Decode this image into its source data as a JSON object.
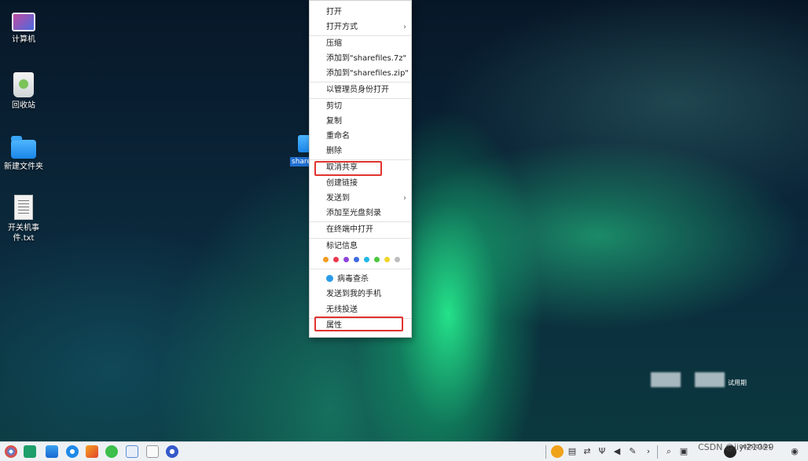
{
  "desktop": {
    "icons": [
      {
        "label": "计算机",
        "icon": "computer-icon"
      },
      {
        "label": "回收站",
        "icon": "recycle-bin-icon"
      },
      {
        "label": "新建文件夹",
        "icon": "folder-icon"
      },
      {
        "label": "开关机事件.txt",
        "icon": "text-file-icon"
      }
    ],
    "selected_file": {
      "label": "share",
      "icon": "folder-icon"
    }
  },
  "context_menu": {
    "items": [
      {
        "label": "打开"
      },
      {
        "label": "打开方式",
        "submenu": true
      },
      {
        "label": "压缩"
      },
      {
        "label": "添加到\"sharefiles.7z\""
      },
      {
        "label": "添加到\"sharefiles.zip\""
      },
      {
        "label": "以管理员身份打开"
      },
      {
        "label": "剪切"
      },
      {
        "label": "复制"
      },
      {
        "label": "重命名"
      },
      {
        "label": "删除"
      },
      {
        "label": "取消共享",
        "highlighted": true
      },
      {
        "label": "创建链接"
      },
      {
        "label": "发送到",
        "submenu": true
      },
      {
        "label": "添加至光盘刻录"
      },
      {
        "label": "在终端中打开"
      },
      {
        "label": "标记信息"
      },
      {
        "label": "病毒查杀",
        "icon": "virus-scan-icon"
      },
      {
        "label": "发送到我的手机"
      },
      {
        "label": "无线投送"
      },
      {
        "label": "属性",
        "highlighted": true
      }
    ],
    "submenu_arrow": "›",
    "tag_colors": [
      "#f39c1f",
      "#e8384f",
      "#8e44d9",
      "#3d6be0",
      "#1fb7e6",
      "#4cc83c",
      "#f1d52a",
      "#bdbdbd"
    ],
    "highlight_color": "#e0332f"
  },
  "trial_notice": {
    "text": "试用期"
  },
  "taskbar": {
    "apps": [
      "launcher-icon",
      "multitask-view-icon",
      "app-store-icon",
      "browser-icon",
      "image-viewer-icon",
      "music-icon",
      "document-icon",
      "notes-icon",
      "settings-icon"
    ],
    "tray": [
      "update-icon",
      "keyboard-icon",
      "network-transfer-icon",
      "usb-icon",
      "volume-icon",
      "pen-icon",
      "expand-icon",
      "search-icon",
      "screenshot-icon",
      "notifications-icon",
      "user-icon"
    ],
    "date": "2025/03/01"
  },
  "watermark": "CSDN @jiyi21029"
}
